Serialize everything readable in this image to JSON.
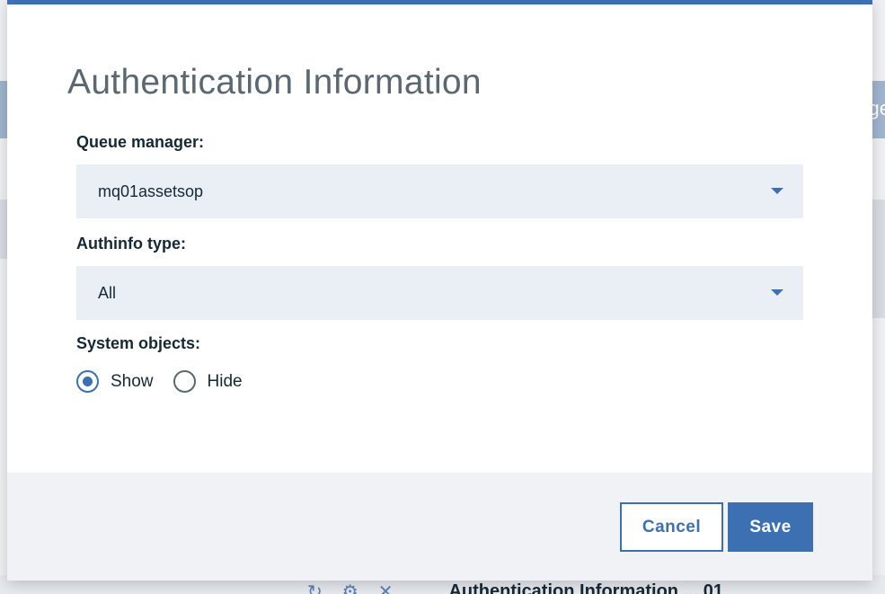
{
  "background": {
    "edge_text": "ge",
    "toolbar_text": "Authentication Information  ...  01"
  },
  "modal": {
    "title": "Authentication Information",
    "queue_manager": {
      "label": "Queue manager:",
      "value": "mq01assetsop"
    },
    "authinfo_type": {
      "label": "Authinfo type:",
      "value": "All"
    },
    "system_objects": {
      "label": "System objects:",
      "options": [
        {
          "label": "Show",
          "checked": true
        },
        {
          "label": "Hide",
          "checked": false
        }
      ]
    },
    "buttons": {
      "cancel": "Cancel",
      "save": "Save"
    }
  },
  "colors": {
    "accent": "#3d70b2",
    "select_bg": "#eaeef5",
    "footer_bg": "#f0f2f5"
  }
}
